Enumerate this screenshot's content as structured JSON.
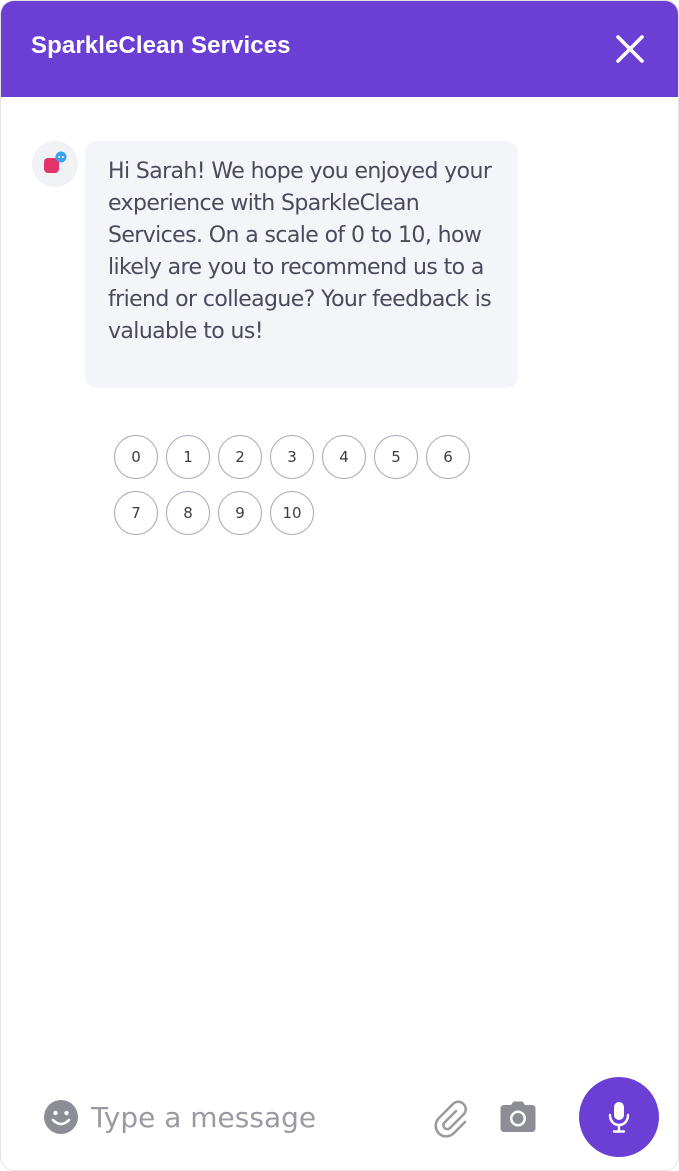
{
  "header": {
    "title": "SparkleClean Services",
    "close_icon": "close-icon",
    "background_color": "#6c3fd4"
  },
  "conversation": {
    "bot_avatar_icon": "chat-bubble-logo-icon",
    "message": "Hi Sarah! We hope you enjoyed your experience with SparkleClean Services. On a scale of 0 to 10, how likely are you to recommend us to a friend or colleague? Your feedback is valuable to us!",
    "rating_options": {
      "row1": [
        "0",
        "1",
        "2",
        "3",
        "4",
        "5",
        "6"
      ],
      "row2": [
        "7",
        "8",
        "9",
        "10"
      ]
    }
  },
  "composer": {
    "placeholder": "Type a message",
    "value": "",
    "emoji_icon": "emoji-icon",
    "attach_icon": "paperclip-icon",
    "camera_icon": "camera-icon",
    "mic_icon": "microphone-icon",
    "accent_color": "#6c3fd4"
  }
}
